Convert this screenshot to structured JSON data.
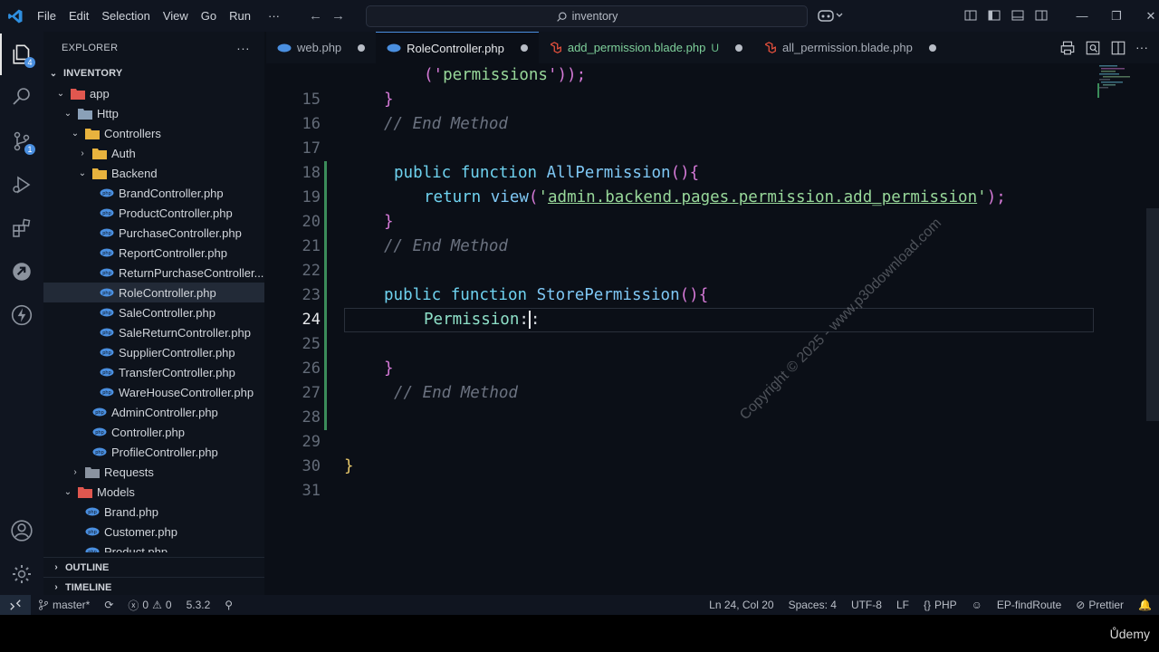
{
  "menu": [
    "File",
    "Edit",
    "Selection",
    "View",
    "Go",
    "Run"
  ],
  "menu_more": "···",
  "search": {
    "text": "inventory"
  },
  "colors": {
    "accent": "#4a8fe0",
    "git_added": "#3b8c5a",
    "keyword": "#6fd3f0",
    "string": "#98d89a"
  },
  "explorer": {
    "title": "EXPLORER",
    "more": "···",
    "root": "INVENTORY",
    "items": [
      {
        "label": "app",
        "kind": "folder-red",
        "depth": 1,
        "open": true
      },
      {
        "label": "Http",
        "kind": "folder",
        "depth": 2,
        "open": true
      },
      {
        "label": "Controllers",
        "kind": "folder-yellow",
        "depth": 3,
        "open": true
      },
      {
        "label": "Auth",
        "kind": "folder-yellow",
        "depth": 4,
        "open": false
      },
      {
        "label": "Backend",
        "kind": "folder-yellow",
        "depth": 4,
        "open": true
      },
      {
        "label": "BrandController.php",
        "kind": "php",
        "depth": 5
      },
      {
        "label": "ProductController.php",
        "kind": "php",
        "depth": 5
      },
      {
        "label": "PurchaseController.php",
        "kind": "php",
        "depth": 5
      },
      {
        "label": "ReportController.php",
        "kind": "php",
        "depth": 5
      },
      {
        "label": "ReturnPurchaseController...",
        "kind": "php",
        "depth": 5
      },
      {
        "label": "RoleController.php",
        "kind": "php",
        "depth": 5,
        "selected": true
      },
      {
        "label": "SaleController.php",
        "kind": "php",
        "depth": 5
      },
      {
        "label": "SaleReturnController.php",
        "kind": "php",
        "depth": 5
      },
      {
        "label": "SupplierController.php",
        "kind": "php",
        "depth": 5
      },
      {
        "label": "TransferController.php",
        "kind": "php",
        "depth": 5
      },
      {
        "label": "WareHouseController.php",
        "kind": "php",
        "depth": 5
      },
      {
        "label": "AdminController.php",
        "kind": "php",
        "depth": 4
      },
      {
        "label": "Controller.php",
        "kind": "php",
        "depth": 4
      },
      {
        "label": "ProfileController.php",
        "kind": "php",
        "depth": 4
      },
      {
        "label": "Requests",
        "kind": "folder-gray",
        "depth": 3,
        "open": false
      },
      {
        "label": "Models",
        "kind": "folder-red",
        "depth": 2,
        "open": true
      },
      {
        "label": "Brand.php",
        "kind": "php",
        "depth": 3
      },
      {
        "label": "Customer.php",
        "kind": "php",
        "depth": 3
      },
      {
        "label": "Product.php",
        "kind": "php",
        "depth": 3
      }
    ],
    "outline": "OUTLINE",
    "timeline": "TIMELINE"
  },
  "activity_badges": {
    "explorer": "4",
    "scm": "1"
  },
  "tabs": [
    {
      "label": "web.php",
      "icon": "php",
      "active": false,
      "dirty": true
    },
    {
      "label": "RoleController.php",
      "icon": "php",
      "active": true,
      "dirty": true
    },
    {
      "label": "add_permission.blade.php",
      "icon": "laravel",
      "active": false,
      "dirty": true,
      "mark": "U",
      "green": true
    },
    {
      "label": "all_permission.blade.php",
      "icon": "laravel",
      "active": false,
      "dirty": true
    }
  ],
  "editor": {
    "line_numbers": [
      "15",
      "16",
      "17",
      "18",
      "19",
      "20",
      "21",
      "22",
      "23",
      "24",
      "25",
      "26",
      "27",
      "28",
      "29",
      "30",
      "31"
    ],
    "current_line": "24",
    "code": {
      "l14_a": "('",
      "l14_b": "permissions",
      "l14_c": "'));",
      "l15": "}",
      "l16": "// End Method",
      "l18_kw": "public function",
      "l18_fn": "AllPermission",
      "l18_p": "(){",
      "l19_kw": "return",
      "l19_fn": "view",
      "l19_s": "admin.backend.pages.permission.add_permission",
      "l19_e": ");",
      "l20": "}",
      "l21": "// End Method",
      "l23_kw": "public function",
      "l23_fn": "StorePermission",
      "l23_p": "(){",
      "l24_cls": "Permission",
      "l24_op": ":",
      "l24_op2": ":",
      "l26": "}",
      "l27": "// End Method",
      "l30": "}"
    },
    "watermark": "Copyright © 2025 - www.p30download.com"
  },
  "status": {
    "branch": "master*",
    "errors": "0",
    "warnings": "0",
    "php_version": "5.3.2",
    "position": "Ln 24, Col 20",
    "spaces": "Spaces: 4",
    "encoding": "UTF-8",
    "eol": "LF",
    "language": "PHP",
    "ext1": "EP-findRoute",
    "ext2": "Prettier"
  },
  "brand": "Ůdemy"
}
